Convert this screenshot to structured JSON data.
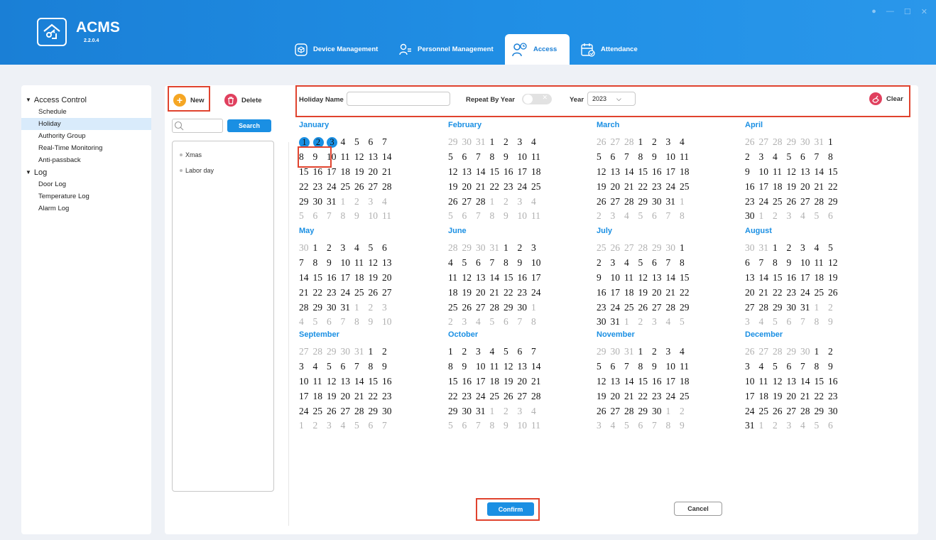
{
  "app": {
    "name": "ACMS",
    "version": "2.2.0.4"
  },
  "nav": {
    "device": "Device Management",
    "personnel": "Personnel Management",
    "access": "Access",
    "attendance": "Attendance"
  },
  "sidebar": {
    "group1": "Access Control",
    "items1": [
      "Schedule",
      "Holiday",
      "Authority Group",
      "Real-Time Monitoring",
      "Anti-passback"
    ],
    "group2": "Log",
    "items2": [
      "Door Log",
      "Temperature Log",
      "Alarm Log"
    ]
  },
  "toolbar": {
    "new_label": "New",
    "delete_label": "Delete",
    "search_label": "Search"
  },
  "holidays": [
    "Xmas",
    "Labor day"
  ],
  "filter": {
    "holiday_name_label": "Holiday Name",
    "holiday_name_value": "",
    "repeat_label": "Repeat By Year",
    "repeat_on": false,
    "year_label": "Year",
    "year_value": "2023",
    "clear_label": "Clear"
  },
  "year": 2023,
  "selected_dates": [
    "2023-01-01",
    "2023-01-02",
    "2023-01-03"
  ],
  "months": [
    "January",
    "February",
    "March",
    "April",
    "May",
    "June",
    "July",
    "August",
    "September",
    "October",
    "November",
    "December"
  ],
  "footer": {
    "confirm": "Confirm",
    "cancel": "Cancel"
  },
  "colors": {
    "accent": "#1a8fe3",
    "highlight": "#e0432e",
    "new": "#f5a623",
    "delete": "#e0405e"
  }
}
